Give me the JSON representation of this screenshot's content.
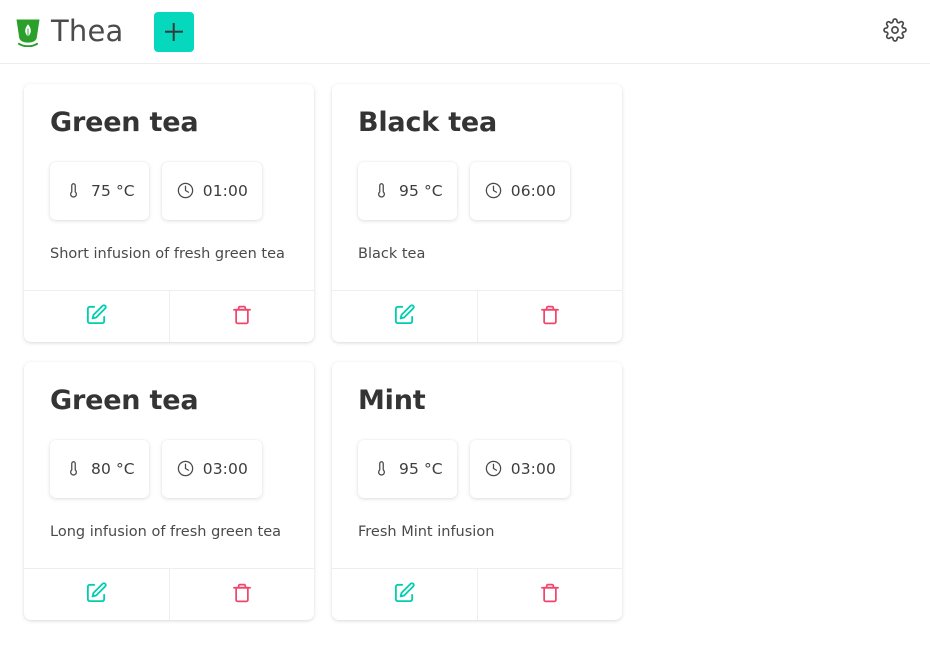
{
  "header": {
    "brand_title": "Thea",
    "logo_icon": "tea-cup-leaf-icon",
    "add_button_label": "+",
    "add_button_icon": "plus-icon",
    "add_button_color": "#05d8bd",
    "settings_icon": "gear-icon"
  },
  "theme": {
    "accent": "#05d8bd",
    "edit_icon_color": "#02cdb1",
    "delete_icon_color": "#f2456c",
    "logo_green": "#2aa02a",
    "page_background": "#ffffff",
    "card_background": "#ffffff",
    "text_primary": "#343434",
    "text_secondary": "#4a4a4a"
  },
  "icons": {
    "temperature": "thermometer-icon",
    "time": "clock-icon",
    "edit": "edit-pencil-icon",
    "delete": "trash-icon"
  },
  "cards": [
    {
      "title": "Green tea",
      "temperature": "75 °C",
      "time": "01:00",
      "description": "Short infusion of fresh green tea"
    },
    {
      "title": "Black tea",
      "temperature": "95 °C",
      "time": "06:00",
      "description": "Black tea"
    },
    {
      "title": "Green tea",
      "temperature": "80 °C",
      "time": "03:00",
      "description": "Long infusion of fresh green tea"
    },
    {
      "title": "Mint",
      "temperature": "95 °C",
      "time": "03:00",
      "description": "Fresh Mint infusion"
    }
  ]
}
